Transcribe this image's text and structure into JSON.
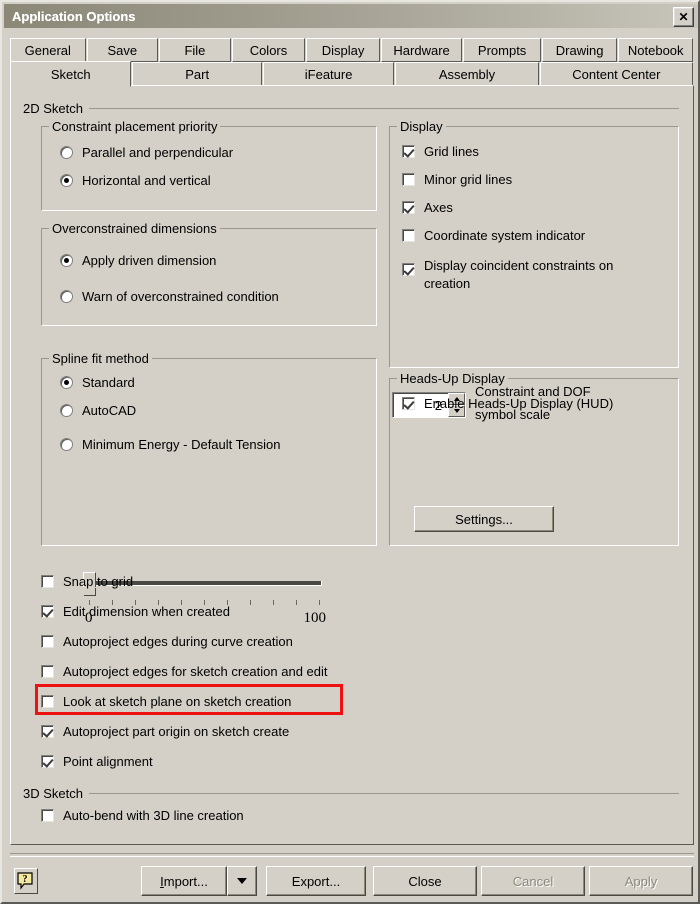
{
  "window": {
    "title": "Application Options",
    "close_icon": "close-icon",
    "close_label": "✕"
  },
  "tabs": {
    "row1": [
      {
        "label": "General",
        "selected": false
      },
      {
        "label": "Save",
        "selected": false
      },
      {
        "label": "File",
        "selected": false
      },
      {
        "label": "Colors",
        "selected": false
      },
      {
        "label": "Display",
        "selected": false
      },
      {
        "label": "Hardware",
        "selected": false
      },
      {
        "label": "Prompts",
        "selected": false
      },
      {
        "label": "Drawing",
        "selected": false
      },
      {
        "label": "Notebook",
        "selected": false
      }
    ],
    "row2": [
      {
        "label": "Sketch",
        "selected": true
      },
      {
        "label": "Part",
        "selected": false
      },
      {
        "label": "iFeature",
        "selected": false
      },
      {
        "label": "Assembly",
        "selected": false
      },
      {
        "label": "Content Center",
        "selected": false
      }
    ]
  },
  "sections": {
    "sketch_2d": "2D Sketch",
    "sketch_3d": "3D Sketch"
  },
  "constraint_priority": {
    "title": "Constraint placement priority",
    "options": [
      {
        "label": "Parallel and perpendicular",
        "selected": false
      },
      {
        "label": "Horizontal and vertical",
        "selected": true
      }
    ]
  },
  "overconstrained": {
    "title": "Overconstrained dimensions",
    "options": [
      {
        "label": "Apply driven dimension",
        "selected": true
      },
      {
        "label": "Warn of overconstrained condition",
        "selected": false
      }
    ]
  },
  "spline_fit": {
    "title": "Spline fit method",
    "options": [
      {
        "label": "Standard",
        "selected": true
      },
      {
        "label": "AutoCAD",
        "selected": false
      },
      {
        "label": "Minimum Energy - Default Tension",
        "selected": false
      }
    ],
    "slider": {
      "min_label": "0",
      "max_label": "100",
      "value": 0,
      "min": 0,
      "max": 100,
      "tick_count": 11
    }
  },
  "display": {
    "title": "Display",
    "checkboxes": [
      {
        "label": "Grid lines",
        "checked": true
      },
      {
        "label": "Minor grid lines",
        "checked": false
      },
      {
        "label": "Axes",
        "checked": true
      },
      {
        "label": "Coordinate system indicator",
        "checked": false
      },
      {
        "label": "Display coincident constraints on creation",
        "checked": true
      }
    ],
    "symbol_scale": {
      "value": "2",
      "label_line1": "Constraint and DOF",
      "label_line2": "symbol scale",
      "up_icon": "spinner-up-icon",
      "down_icon": "spinner-down-icon"
    }
  },
  "heads_up": {
    "title": "Heads-Up Display",
    "enable": {
      "label": "Enable Heads-Up Display (HUD)",
      "checked": true
    },
    "settings_button": "Settings..."
  },
  "bottom_options": [
    {
      "label": "Snap to grid",
      "checked": false,
      "highlighted": false
    },
    {
      "label": "Edit dimension when created",
      "checked": true,
      "highlighted": false
    },
    {
      "label": "Autoproject edges during curve creation",
      "checked": false,
      "highlighted": false
    },
    {
      "label": "Autoproject edges for sketch creation and edit",
      "checked": false,
      "highlighted": false
    },
    {
      "label": "Look at sketch plane on sketch creation",
      "checked": false,
      "highlighted": true
    },
    {
      "label": "Autoproject part origin on sketch create",
      "checked": true,
      "highlighted": false
    },
    {
      "label": "Point alignment",
      "checked": true,
      "highlighted": false
    }
  ],
  "sketch3d_options": [
    {
      "label": "Auto-bend with 3D line creation",
      "checked": false
    }
  ],
  "highlight": {
    "color": "#ee1111",
    "target": "Look at sketch plane on sketch creation"
  },
  "footer": {
    "help_icon": "help-question-icon",
    "help_glyph": "?",
    "import_label": "Import...",
    "import_accel": "I",
    "import_rest": "mport...",
    "import_dropdown_icon": "chevron-down-icon",
    "export_label": "Export...",
    "close_label": "Close",
    "cancel_label": "Cancel",
    "cancel_disabled": true,
    "apply_label": "Apply",
    "apply_disabled": true
  },
  "colors": {
    "dialog_face": "#d4d0c8",
    "title_gradient_start": "#8b8878",
    "title_gradient_end": "#c8c5ba",
    "highlight_red": "#ee1111",
    "help_yellow": "#f5e9a0"
  }
}
